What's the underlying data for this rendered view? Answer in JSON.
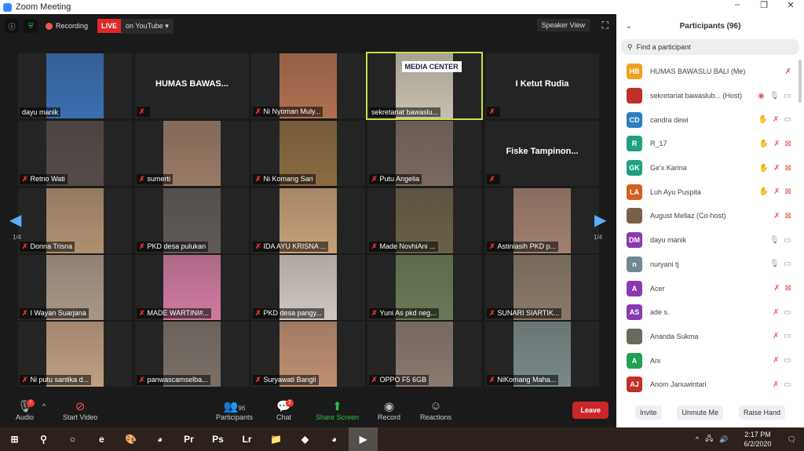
{
  "window": {
    "title": "Zoom Meeting",
    "minimize": "–",
    "maximize": "❐",
    "close": "✕"
  },
  "topbar": {
    "info": "ⓘ",
    "recording": "Recording",
    "live": "LIVE",
    "live_target": "on YouTube ▾",
    "speaker_view": "Speaker View",
    "fullscreen": "⛶"
  },
  "gallery": {
    "page_left": "1/4",
    "page_right": "1/4",
    "prev": "◀",
    "next": "▶",
    "active_index": 3,
    "tiles": [
      {
        "name": "dayu manik",
        "video": "#3a6fb0",
        "muted": false
      },
      {
        "name": "",
        "label": "HUMAS BAWAS...",
        "video": "",
        "muted": true
      },
      {
        "name": "Ni Nyoman Muly...",
        "video": "#b07050",
        "muted": true
      },
      {
        "name": "sekretariat bawaslu...",
        "video": "#c8c0b0",
        "muted": false,
        "banner": "MEDIA CENTER"
      },
      {
        "name": "",
        "label": "I Ketut Rudia",
        "video": "",
        "muted": true
      },
      {
        "name": "Retno Wati",
        "video": "#554a48",
        "muted": true
      },
      {
        "name": "sumerti",
        "video": "#9a7a66",
        "muted": true
      },
      {
        "name": "Ni Komang Sari",
        "video": "#8a6a40",
        "muted": true
      },
      {
        "name": "Putu Angelia",
        "video": "#7a6a60",
        "muted": true
      },
      {
        "name": "",
        "label": "Fiske  Tampinon...",
        "video": "",
        "muted": true
      },
      {
        "name": "Donna Trisna",
        "video": "#b09070",
        "muted": true
      },
      {
        "name": "PKD desa pulukan",
        "video": "#605a58",
        "muted": true
      },
      {
        "name": "IDA AYU KRISNA ...",
        "video": "#c8a078",
        "muted": true
      },
      {
        "name": "Made NovhiAni ...",
        "video": "#6a6048",
        "muted": true
      },
      {
        "name": "Astiniasih PKD p...",
        "video": "#a08070",
        "muted": true
      },
      {
        "name": "I Wayan Suarjana",
        "video": "#a89888",
        "muted": true
      },
      {
        "name": "MADE WARTINI#...",
        "video": "#d07aa0",
        "muted": true
      },
      {
        "name": "PKD desa pangy...",
        "video": "#d0c8c0",
        "muted": true
      },
      {
        "name": "Yuni As pkd neg...",
        "video": "#6a7a58",
        "muted": true
      },
      {
        "name": "SUNARI SIARTIK...",
        "video": "#8a7a6a",
        "muted": true
      },
      {
        "name": "Ni putu santika d...",
        "video": "#c0a080",
        "muted": true
      },
      {
        "name": "panwascamselba...",
        "video": "#7a7068",
        "muted": true
      },
      {
        "name": "Suryawati Bangli",
        "video": "#c09070",
        "muted": true
      },
      {
        "name": "OPPO F5 6GB",
        "video": "#8a7a70",
        "muted": true
      },
      {
        "name": "NiKomang Maha...",
        "video": "#7a8a88",
        "muted": true
      }
    ]
  },
  "toolbar": {
    "audio": "Audio",
    "audio_badge": "!",
    "start_video": "Start Video",
    "participants": "Participants",
    "participants_count": "96",
    "chat": "Chat",
    "chat_badge": "2",
    "share_screen": "Share Screen",
    "record": "Record",
    "reactions": "Reactions",
    "leave": "Leave"
  },
  "panel": {
    "title": "Participants (96)",
    "search_placeholder": "Find a participant",
    "participants": [
      {
        "initials": "HB",
        "color": "#f0a020",
        "name": "HUMAS BAWASLU BALI (Me)",
        "icons": [
          "mic-muted"
        ]
      },
      {
        "initials": "",
        "color": "#c0302a",
        "name": "sekretariat bawaslub...  (Host)",
        "icons": [
          "recording",
          "mic",
          "video"
        ]
      },
      {
        "initials": "CD",
        "color": "#2a7fc0",
        "name": "candra dewi",
        "icons": [
          "hand",
          "mic-muted",
          "video"
        ]
      },
      {
        "initials": "R",
        "color": "#20a080",
        "name": "R_17",
        "icons": [
          "hand",
          "mic-muted",
          "video-off"
        ]
      },
      {
        "initials": "GK",
        "color": "#20a080",
        "name": "Ge'x Karina",
        "icons": [
          "hand",
          "mic-muted",
          "video-off"
        ]
      },
      {
        "initials": "LA",
        "color": "#d06020",
        "name": "Luh Ayu Puspita",
        "icons": [
          "hand",
          "mic-muted",
          "video-off"
        ]
      },
      {
        "initials": "",
        "color": "#7a6048",
        "name": "August Mellaz (Co-host)",
        "icons": [
          "mic-muted",
          "video-off"
        ]
      },
      {
        "initials": "DM",
        "color": "#8a3ab0",
        "name": "dayu manik",
        "icons": [
          "mic",
          "video"
        ]
      },
      {
        "initials": "n",
        "color": "#708890",
        "name": "nuryani tj",
        "icons": [
          "mic",
          "video"
        ]
      },
      {
        "initials": "A",
        "color": "#8a3ab0",
        "name": "Acer",
        "icons": [
          "mic-muted",
          "video-off"
        ]
      },
      {
        "initials": "AS",
        "color": "#8a3ab0",
        "name": "ade s.",
        "icons": [
          "mic-muted",
          "video"
        ]
      },
      {
        "initials": "",
        "color": "#6a6a5a",
        "name": "Ananda Sukma",
        "icons": [
          "mic-muted",
          "video"
        ]
      },
      {
        "initials": "A",
        "color": "#20a050",
        "name": "Ani",
        "icons": [
          "mic-muted",
          "video"
        ]
      },
      {
        "initials": "AJ",
        "color": "#c03028",
        "name": "Anom Januwintari",
        "icons": [
          "mic-muted",
          "video"
        ]
      }
    ],
    "invite": "Invite",
    "unmute": "Unmute Me",
    "raise_hand": "Raise Hand"
  },
  "taskbar": {
    "apps": [
      "start",
      "search",
      "cortana",
      "edge",
      "paint",
      "chrome",
      "premiere",
      "photoshop",
      "lightroom",
      "explorer",
      "coreldraw",
      "chrome-user",
      "zoom"
    ],
    "time": "2:17 PM",
    "date": "6/2/2020"
  }
}
